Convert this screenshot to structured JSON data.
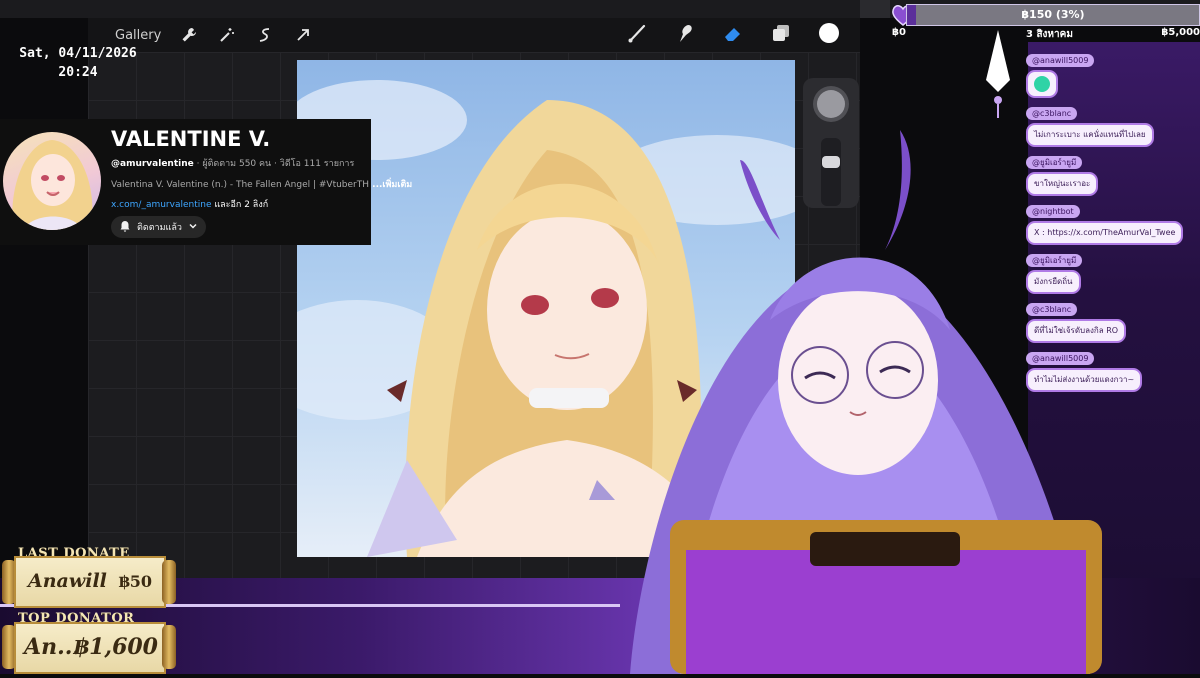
{
  "app": {
    "gallery_label": "Gallery",
    "toolbar_left_icons": [
      "wrench-icon",
      "magic-wand-icon",
      "selection-icon",
      "transform-arrow-icon"
    ],
    "toolbar_right_icons": [
      "brush-icon",
      "smudge-icon",
      "eraser-icon",
      "layers-icon",
      "color-swatch-icon"
    ],
    "accent": "#2f8cf0"
  },
  "datetime": {
    "date": "Sat, 04/11/2026",
    "time": "20:24"
  },
  "channel": {
    "name": "VALENTINE V.",
    "handle": "@amurvalentine",
    "stats": " · ผู้ติดตาม 550 คน · วิดีโอ 111 รายการ",
    "description": "Valentina V. Valentine (n.) - The Fallen Angel | #VtuberTH",
    "more_label": " ...เพิ่มเติม",
    "link": "x.com/_amurvalentine",
    "link_suffix": " และอีก 2 ลิงก์",
    "subscribed_label": "ติดตามแล้ว"
  },
  "goal": {
    "current_text": "฿150 (3%)",
    "progress_percent": 3,
    "min_label": "฿0",
    "date_label": "3 สิงหาคม",
    "max_label": "฿5,000"
  },
  "chat": [
    {
      "user": "@anawill5009",
      "message": "",
      "emote": true
    },
    {
      "user": "@c3blanc",
      "message": "ไม่เการะเบาะ แคนั่งแทนที่ไปเลย"
    },
    {
      "user": "@ยูมิเอร์ายูมี",
      "message": "ขาใหญ่นะเราอะ"
    },
    {
      "user": "@nightbot",
      "message": "X : https://x.com/TheAmurVal_Twee"
    },
    {
      "user": "@ยูมิเอร์ายูมี",
      "message": "มังกรยืดถิ่น"
    },
    {
      "user": "@c3blanc",
      "message": "ดีที่ไม่ใช่เจ้รดับลงกิล RO"
    },
    {
      "user": "@anawill5009",
      "message": "ทำไมไม่ส่งงานด้วยแดงกวา~"
    }
  ],
  "donations": {
    "last_label": "LAST DONATE",
    "last_name": "Anawill",
    "last_amount": "฿50",
    "top_label": "TOP DONATOR",
    "top_name": "An...",
    "top_amount": "฿1,600"
  }
}
